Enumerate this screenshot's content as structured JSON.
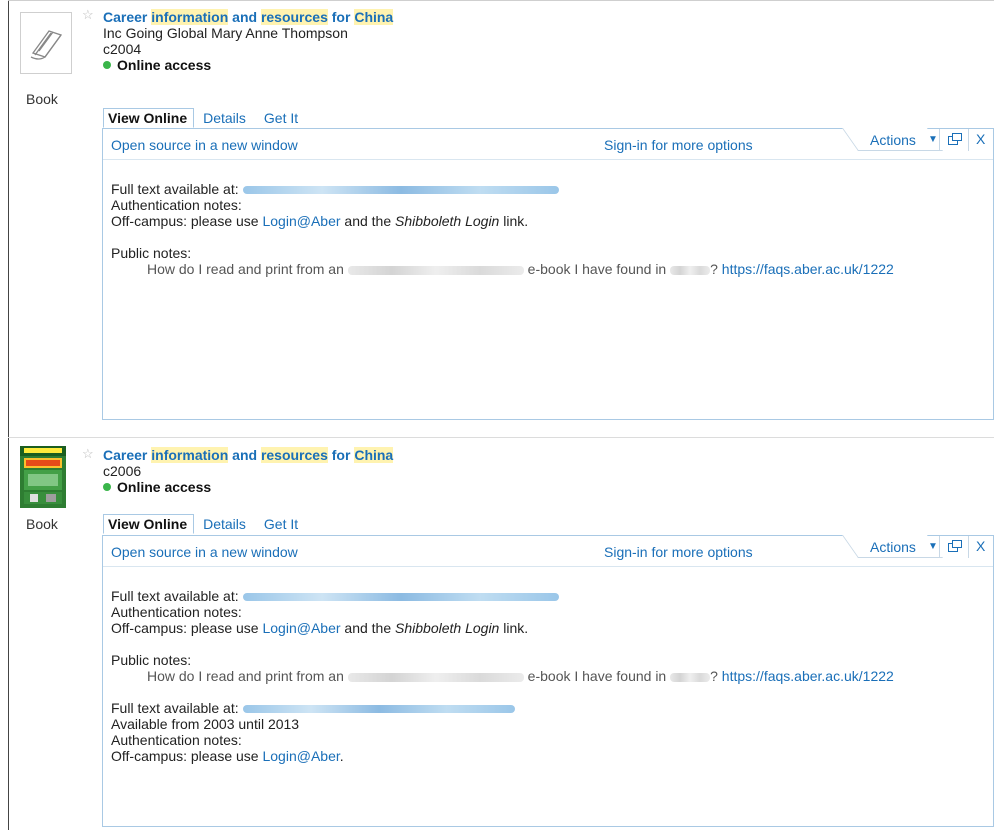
{
  "records": [
    {
      "title_pre": "Career ",
      "title_hl1": "information",
      "title_mid1": " and ",
      "title_hl2": "resources",
      "title_mid2": " for ",
      "title_hl3": "China",
      "author": "Inc Going Global Mary Anne Thompson",
      "date": "c2004",
      "access": "Online access",
      "type_label": "Book",
      "tabs": [
        "View Online",
        "Details",
        "Get It"
      ],
      "toolbar": {
        "open_source": "Open source in a new window",
        "signin": "Sign-in for more options",
        "actions": "Actions",
        "close": "X"
      },
      "fulltext_label": "Full text available at:",
      "auth_notes": "Authentication notes:",
      "offcampus_pre": "Off-campus: please use ",
      "offcampus_link": "Login@Aber",
      "offcampus_mid": " and the ",
      "offcampus_em": "Shibboleth Login",
      "offcampus_post": " link.",
      "public_notes": "Public notes:",
      "note_pre": "How do I read and print from an",
      "note_mid": "e-book I have found in",
      "note_q": "?",
      "note_link": "https://faqs.aber.ac.uk/1222"
    },
    {
      "title_pre": "Career ",
      "title_hl1": "information",
      "title_mid1": " and ",
      "title_hl2": "resources",
      "title_mid2": " for ",
      "title_hl3": "China",
      "date": "c2006",
      "access": "Online access",
      "type_label": "Book",
      "tabs": [
        "View Online",
        "Details",
        "Get It"
      ],
      "toolbar": {
        "open_source": "Open source in a new window",
        "signin": "Sign-in for more options",
        "actions": "Actions",
        "close": "X"
      },
      "fulltext_label": "Full text available at:",
      "auth_notes": "Authentication notes:",
      "offcampus_pre": "Off-campus: please use ",
      "offcampus_link": "Login@Aber",
      "offcampus_mid": " and the ",
      "offcampus_em": "Shibboleth Login",
      "offcampus_post": " link.",
      "public_notes": "Public notes:",
      "note_pre": "How do I read and print from an",
      "note_mid": "e-book I have found in",
      "note_q": "?",
      "note_link": "https://faqs.aber.ac.uk/1222",
      "fulltext2_label": "Full text available at:",
      "available_range": "Available from 2003 until 2013",
      "auth_notes2": "Authentication notes:",
      "offcampus2_pre": "Off-campus: please use ",
      "offcampus2_link": "Login@Aber",
      "offcampus2_post": "."
    }
  ],
  "colors": {
    "link": "#1a6fb8",
    "highlight": "#fff3b0",
    "online_dot": "#3ab54a",
    "panel_border": "#a9c9e4"
  },
  "icons": {
    "favorite": "star-outline-icon",
    "new_window": "new-window-icon",
    "dropdown": "chevron-down-icon"
  }
}
